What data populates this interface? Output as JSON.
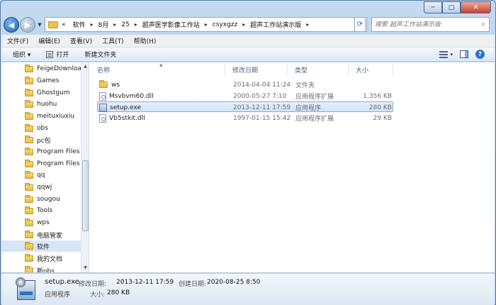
{
  "window": {
    "controls": {
      "minimize": "─",
      "maximize": "□",
      "close": "✕"
    }
  },
  "navbar": {
    "back_icon": "arrow-left-icon",
    "forward_icon": "arrow-right-icon",
    "overflow": "«",
    "breadcrumbs": [
      "软件",
      "8月",
      "25",
      "超声医学影像工作站",
      "csyxgzz",
      "超声工作站演示版"
    ],
    "search_placeholder": "搜索 超声工作站演示版",
    "refresh_icon": "refresh-icon",
    "search_icon": "search-icon"
  },
  "menubar": {
    "items": [
      "文件(F)",
      "编辑(E)",
      "查看(V)",
      "工具(T)",
      "帮助(H)"
    ]
  },
  "toolbar": {
    "organize": "组织 ▾",
    "open": "打开",
    "new_folder": "新建文件夹",
    "view_arrow": "▾",
    "help": "?"
  },
  "navpane": {
    "items": [
      {
        "label": "FeigeDownloa",
        "selected": false
      },
      {
        "label": "Games",
        "selected": false
      },
      {
        "label": "Ghostgum",
        "selected": false
      },
      {
        "label": "huohu",
        "selected": false
      },
      {
        "label": "meituxiuxiu",
        "selected": false
      },
      {
        "label": "obs",
        "selected": false
      },
      {
        "label": "pc包",
        "selected": false
      },
      {
        "label": "Program Files",
        "selected": false
      },
      {
        "label": "Program Files",
        "selected": false
      },
      {
        "label": "qq",
        "selected": false
      },
      {
        "label": "qqwj",
        "selected": false
      },
      {
        "label": "sougou",
        "selected": false
      },
      {
        "label": "Tools",
        "selected": false
      },
      {
        "label": "wps",
        "selected": false
      },
      {
        "label": "电脑管家",
        "selected": false
      },
      {
        "label": "软件",
        "selected": true
      },
      {
        "label": "我的文档",
        "selected": false
      },
      {
        "label": "新obs",
        "selected": false
      }
    ],
    "scroll_up": "▲",
    "scroll_down": "▼"
  },
  "filelist": {
    "columns": {
      "name": "名称",
      "modified": "修改日期",
      "type": "类型",
      "size": "大小"
    },
    "sort_arrow": "▲",
    "rows": [
      {
        "name": "ws",
        "modified": "2014-04-04 11:24",
        "type": "文件夹",
        "size": "",
        "icon": "folder-icon",
        "selected": false
      },
      {
        "name": "Msvbvm60.dll",
        "modified": "2000-05-27 7:10",
        "type": "应用程序扩展",
        "size": "1,356 KB",
        "icon": "dll-icon",
        "selected": false
      },
      {
        "name": "setup.exe",
        "modified": "2013-12-11 17:59",
        "type": "应用程序",
        "size": "280 KB",
        "icon": "exe-icon",
        "selected": true
      },
      {
        "name": "Vb5stkit.dll",
        "modified": "1997-01-15 15:42",
        "type": "应用程序扩展",
        "size": "29 KB",
        "icon": "dll-icon",
        "selected": false
      }
    ]
  },
  "details": {
    "name": "setup.exe",
    "type": "应用程序",
    "modified_label": "修改日期:",
    "modified_value": "2013-12-11 17:59",
    "created_label": "创建日期:",
    "created_value": "2020-08-25 8:50",
    "size_label": "大小:",
    "size_value": "280 KB"
  }
}
